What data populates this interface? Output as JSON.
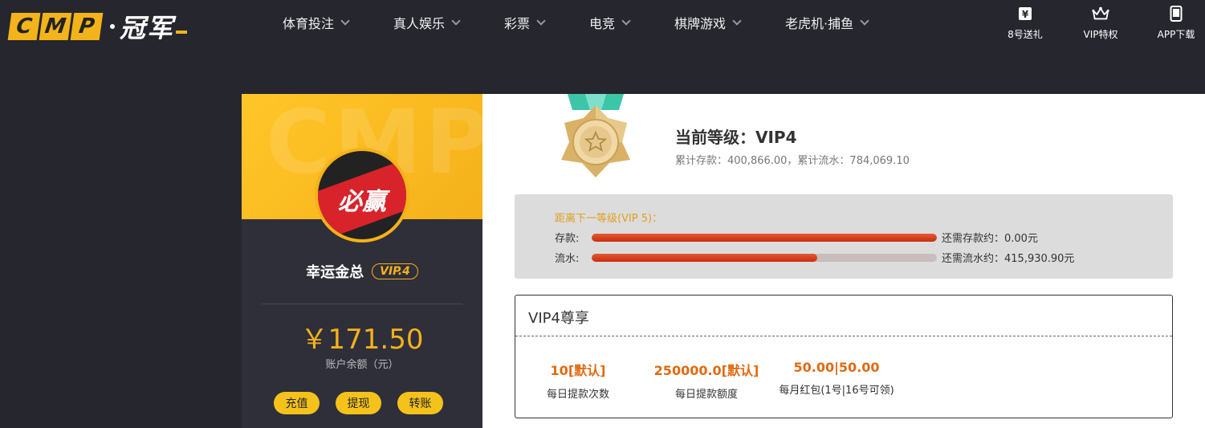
{
  "header": {
    "logo_letters": [
      "C",
      "M",
      "P"
    ],
    "logo_cn": "冠军",
    "nav": [
      {
        "label": "体育投注"
      },
      {
        "label": "真人娱乐"
      },
      {
        "label": "彩票"
      },
      {
        "label": "电竞"
      },
      {
        "label": "棋牌游戏"
      },
      {
        "label": "老虎机·捕鱼"
      }
    ],
    "right_links": [
      {
        "label": "8号送礼",
        "icon": "ticket-icon"
      },
      {
        "label": "VIP特权",
        "icon": "crown-icon"
      },
      {
        "label": "APP下载",
        "icon": "tablet-icon"
      }
    ]
  },
  "profile": {
    "watermark": "CMP",
    "avatar_text": "必赢",
    "username": "幸运金总",
    "vip_badge": "VIP.4",
    "balance": "￥171.50",
    "balance_label": "账户余额（元）",
    "actions": [
      "充值",
      "提现",
      "转账"
    ]
  },
  "level": {
    "title": "当前等级：VIP4",
    "subtitle": "累计存款：400,866.00，累计流水：784,069.10"
  },
  "progress": {
    "title": "距离下一等级(VIP 5)：",
    "rows": [
      {
        "label": "存款:",
        "fraction": 1.0,
        "need": "还需存款约：0.00元"
      },
      {
        "label": "流水:",
        "fraction": 0.654,
        "need": "还需流水约：415,930.90元"
      }
    ]
  },
  "vip_perks": {
    "title": "VIP4尊享",
    "perks": [
      {
        "value": "10[默认]",
        "label": "每日提款次数"
      },
      {
        "value": "250000.0[默认]",
        "label": "每日提款额度"
      },
      {
        "value": "50.00|50.00",
        "label": "每月红包(1号|16号可领)"
      }
    ]
  },
  "colors": {
    "accent": "#f5b11a",
    "header_bg": "#26262f",
    "progress_fill": "#d0341a",
    "perk_value": "#e06a12"
  }
}
